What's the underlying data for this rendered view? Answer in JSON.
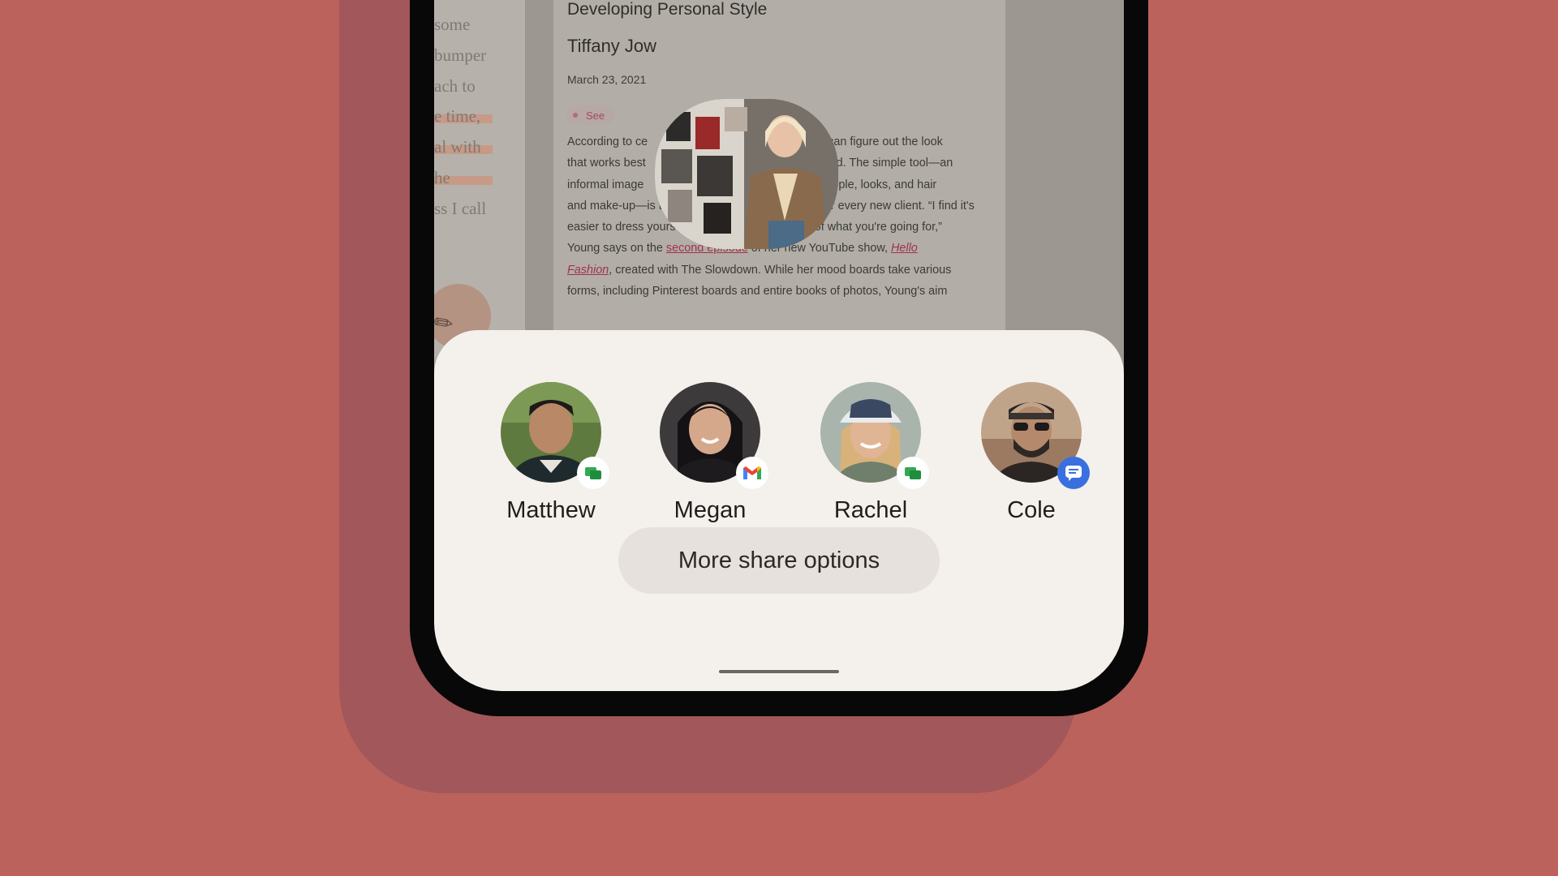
{
  "article": {
    "title": "Developing Personal Style",
    "author": "Tiffany Jow",
    "date": "March 23, 2021",
    "chip_label": "See",
    "body_1": "According to ce",
    "body_1b": "e can figure out the look",
    "body_2": "that works best",
    "body_2b": "ard. The simple tool—an",
    "body_3": "informal image ",
    "body_3b": "people, looks, and hair",
    "body_4": "and make-up—is t",
    "body_4b": "or every new client. “I find it's",
    "body_5": "easier to dress yourself when you have an idea of what you're going for,”",
    "body_6a": "Young says on the ",
    "link_episode": "second episode",
    "body_6b": " of her new YouTube show, ",
    "link_show_1": "Hello",
    "link_show_2": "Fashion",
    "body_7": ", created with The Slowdown. While her mood boards take various",
    "body_8": "forms, including Pinterest boards and entire books of photos, Young's aim"
  },
  "left_doc": {
    "lines": [
      "some",
      "bumper",
      "ach to",
      "e time,",
      "al with",
      "he",
      "ss I call"
    ]
  },
  "share_sheet": {
    "contacts": [
      {
        "name": "Matthew",
        "app": "google-messages-icon",
        "color": "#34a853"
      },
      {
        "name": "Megan",
        "app": "gmail-icon",
        "color": "#ea4335"
      },
      {
        "name": "Rachel",
        "app": "google-messages-icon",
        "color": "#34a853"
      },
      {
        "name": "Cole",
        "app": "messages-icon",
        "color": "#3a6fe0"
      }
    ],
    "more_options_label": "More share options"
  },
  "colors": {
    "background": "#bb625c",
    "sheet": "#f4f1ec",
    "link": "#a3304e"
  }
}
